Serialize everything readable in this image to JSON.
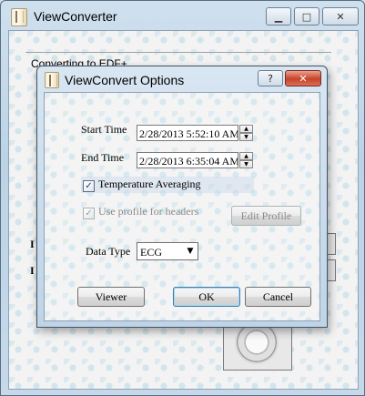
{
  "outer_window": {
    "title": "ViewConverter",
    "status_text": "Converting to EDF+...",
    "left_labels": [
      "I",
      "I"
    ],
    "buttons": {
      "minimize": "▁",
      "maximize": "□",
      "close": "✕"
    }
  },
  "dialog": {
    "title": "ViewConvert Options",
    "buttons": {
      "help": "?",
      "close": "✕"
    },
    "start_time": {
      "label": "Start Time",
      "value": "2/28/2013 5:52:10 AM"
    },
    "end_time": {
      "label": "End Time",
      "value": "2/28/2013 6:35:04 AM"
    },
    "temperature_averaging": {
      "label": "Temperature Averaging",
      "checked": true
    },
    "use_profile": {
      "label": "Use profile for headers",
      "checked": true,
      "enabled": false
    },
    "edit_profile_label": "Edit Profile",
    "data_type": {
      "label": "Data Type",
      "value": "ECG"
    },
    "viewer_label": "Viewer",
    "ok_label": "OK",
    "cancel_label": "Cancel"
  },
  "icons": {
    "app": "app-icon",
    "check": "✓",
    "spin_up": "▲",
    "spin_down": "▼",
    "dropdown": "▼"
  }
}
